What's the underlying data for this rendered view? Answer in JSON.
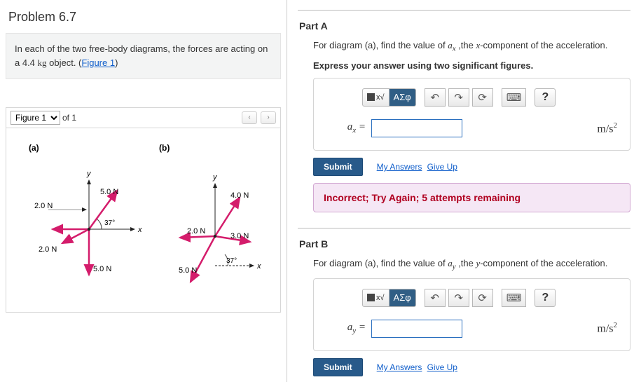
{
  "problem": {
    "title": "Problem 6.7",
    "prompt_prefix": "In each of the two free-body diagrams, the forces are acting on a 4.4 ",
    "prompt_unit": "kg",
    "prompt_suffix": " object. (",
    "figure_link": "Figure 1",
    "prompt_close": ")"
  },
  "figure_bar": {
    "selected": "Figure 1",
    "of_label": "of 1",
    "prev": "‹",
    "next": "›"
  },
  "figure": {
    "a_label": "(a)",
    "b_label": "(b)",
    "a": {
      "f1": "5.0 N",
      "f2": "2.0 N",
      "f3": "2.0 N",
      "f4": "5.0 N",
      "angle": "37°",
      "x": "x",
      "y": "y"
    },
    "b": {
      "f1": "4.0 N",
      "f2": "2.0 N",
      "f3": "3.0 N",
      "f4": "5.0 N",
      "angle": "37°",
      "x": "x",
      "y": "y"
    }
  },
  "toolbar": {
    "templates": "▯√▯",
    "greek": "ΑΣφ",
    "undo": "↶",
    "redo": "↷",
    "reset": "⟳",
    "keyboard": "⌨",
    "help": "?"
  },
  "partA": {
    "heading": "Part A",
    "desc_pre": "For diagram (a), find the value of ",
    "var": "a",
    "sub": "x",
    "desc_mid": " ,the ",
    "component": "x",
    "desc_post": "-component of the acceleration.",
    "instruction": "Express your answer using two significant figures.",
    "lhs_var": "a",
    "lhs_sub": "x",
    "eq": " = ",
    "unit": "m/s",
    "unit_sup": "2",
    "submit": "Submit",
    "my_answers": "My Answers",
    "give_up": "Give Up",
    "feedback": "Incorrect; Try Again; 5 attempts remaining"
  },
  "partB": {
    "heading": "Part B",
    "desc_pre": "For diagram (a), find the value of ",
    "var": "a",
    "sub": "y",
    "desc_mid": " ,the ",
    "component": "y",
    "desc_post": "-component of the acceleration.",
    "lhs_var": "a",
    "lhs_sub": "y",
    "eq": " = ",
    "unit": "m/s",
    "unit_sup": "2",
    "submit": "Submit",
    "my_answers": "My Answers",
    "give_up": "Give Up"
  }
}
